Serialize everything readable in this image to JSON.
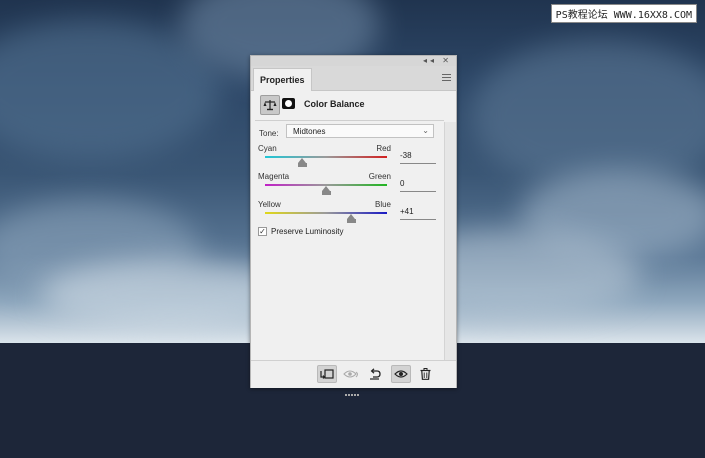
{
  "watermark": "PS教程论坛 WWW.16XX8.COM",
  "panel": {
    "tab_label": "Properties",
    "header_title": "Color Balance",
    "tone": {
      "label": "Tone:",
      "value": "Midtones"
    },
    "sliders": [
      {
        "left_label": "Cyan",
        "right_label": "Red",
        "value": "-38",
        "colors": [
          "#1fc6d6",
          "#d22020"
        ],
        "level": -38
      },
      {
        "left_label": "Magenta",
        "right_label": "Green",
        "value": "0",
        "colors": [
          "#c021c6",
          "#22b522"
        ],
        "level": 0
      },
      {
        "left_label": "Yellow",
        "right_label": "Blue",
        "value": "+41",
        "colors": [
          "#e0d81a",
          "#1a1ac4"
        ],
        "level": 41
      }
    ],
    "preserve_luminosity": {
      "label": "Preserve Luminosity",
      "checked": true
    },
    "footer_icons": [
      "clip-to-layer-icon",
      "view-previous-state-icon",
      "reset-icon",
      "visibility-eye-icon",
      "trash-icon"
    ]
  }
}
